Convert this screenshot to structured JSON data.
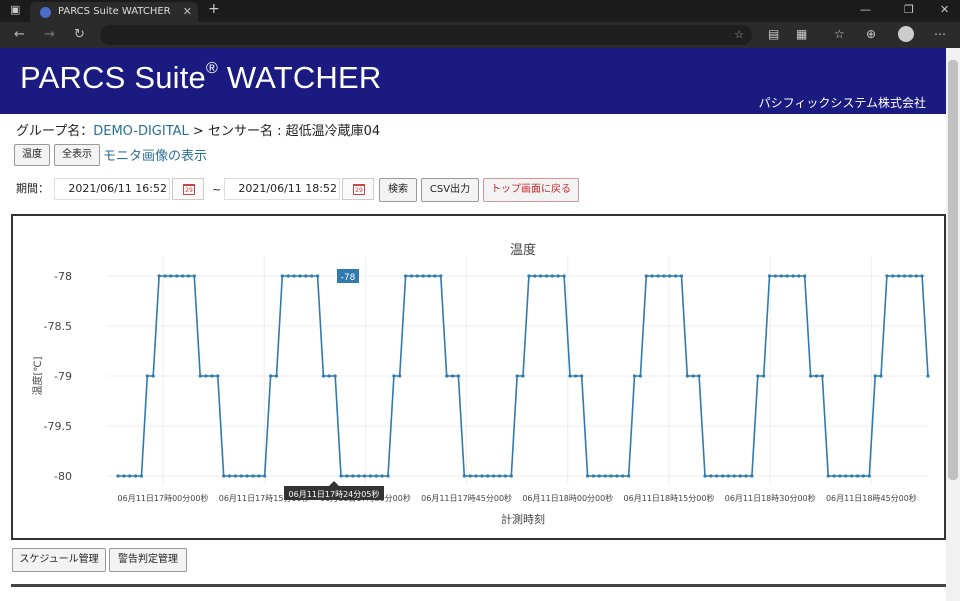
{
  "browser": {
    "tab_title": "PARCS Suite WATCHER",
    "new_tab_symbol": "+"
  },
  "header": {
    "title": "PARCS Suite",
    "title_mark": "®",
    "title_suffix": "WATCHER",
    "company": "パシフィックシステム株式会社",
    "background_color": "#1a1a80"
  },
  "breadcrumb": {
    "group_label": "グループ名：",
    "group_value": "DEMO-DIGITAL",
    "separator": " > センサー名 : ",
    "sensor_value": "超低温冷蔵庫04"
  },
  "view_buttons": {
    "temperature": "温度",
    "show_all": "全表示",
    "monitor_link": "モニタ画像の表示"
  },
  "period": {
    "label": "期間：",
    "start": "2021/06/11 16:52",
    "end": "2021/06/11 18:52",
    "tilde": "~",
    "calendar_day": "29"
  },
  "actions": {
    "search": "検索",
    "csv": "CSV出力",
    "back_top": "トップ画面に戻る"
  },
  "footer_buttons": {
    "schedule": "スケジュール管理",
    "alert_rules": "警告判定管理"
  },
  "chart_data": {
    "type": "line",
    "title": "温度",
    "xlabel": "計測時刻",
    "ylabel": "温度[℃]",
    "ylim": [
      -80.05,
      -77.95
    ],
    "y_ticks": [
      "-78",
      "-78.5",
      "-79",
      "-79.5",
      "-80"
    ],
    "x_ticks": [
      "06月11日17時00分00秒",
      "06月11日17時15分00秒",
      "06月11日17時30分00秒",
      "06月11日17時45分00秒",
      "06月11日18時00分00秒",
      "06月11日18時15分00秒",
      "06月11日18時30分00秒",
      "06月11日18時45分00秒"
    ],
    "tooltip": {
      "value": "-78",
      "x_label": "06月11日17時24分05秒"
    },
    "line_color": "#2f7ab0",
    "grid": true,
    "series": [
      {
        "values": [
          -80,
          -80,
          -80,
          -80,
          -80,
          -79,
          -79,
          -78,
          -78,
          -78,
          -78,
          -78,
          -78,
          -78,
          -79,
          -79,
          -79,
          -79,
          -80,
          -80,
          -80,
          -80,
          -80,
          -80,
          -80,
          -80,
          -79,
          -79,
          -78,
          -78,
          -78,
          -78,
          -78,
          -78,
          -78,
          -79,
          -79,
          -79,
          -80,
          -80,
          -80,
          -80,
          -80,
          -80,
          -80,
          -80,
          -80,
          -79,
          -79,
          -78,
          -78,
          -78,
          -78,
          -78,
          -78,
          -78,
          -79,
          -79,
          -79,
          -80,
          -80,
          -80,
          -80,
          -80,
          -80,
          -80,
          -80,
          -80,
          -79,
          -79,
          -78,
          -78,
          -78,
          -78,
          -78,
          -78,
          -78,
          -79,
          -79,
          -79,
          -80,
          -80,
          -80,
          -80,
          -80,
          -80,
          -80,
          -80,
          -79,
          -79,
          -78,
          -78,
          -78,
          -78,
          -78,
          -78,
          -78,
          -79,
          -79,
          -79,
          -80,
          -80,
          -80,
          -80,
          -80,
          -80,
          -80,
          -80,
          -80,
          -79,
          -79,
          -78,
          -78,
          -78,
          -78,
          -78,
          -78,
          -78,
          -79,
          -79,
          -79,
          -80,
          -80,
          -80,
          -80,
          -80,
          -80,
          -80,
          -80,
          -79,
          -79,
          -78,
          -78,
          -78,
          -78,
          -78,
          -78,
          -78,
          -79
        ]
      }
    ]
  }
}
